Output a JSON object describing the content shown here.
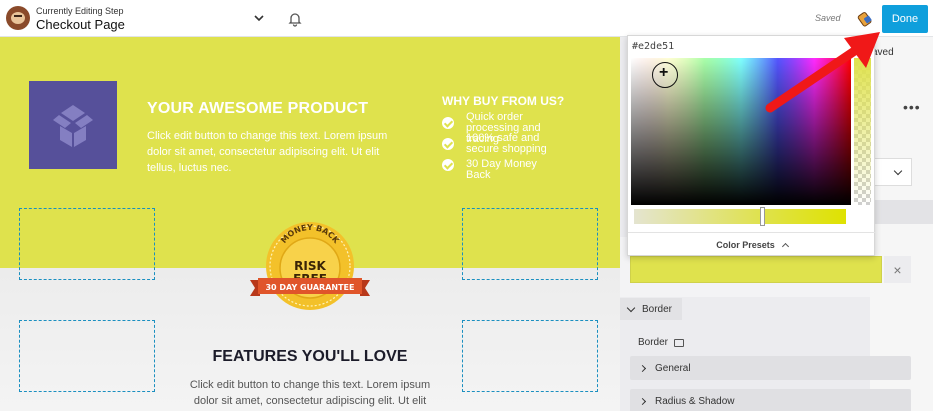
{
  "topbar": {
    "step_label": "Currently Editing Step",
    "step_title": "Checkout Page",
    "saved_text": "Saved",
    "done_label": "Done",
    "accent_color": "#0f9fdc"
  },
  "canvas": {
    "hero": {
      "background": "#dfe24d",
      "product_title": "YOUR AWESOME PRODUCT",
      "product_text": "Click edit button to change this text. Lorem ipsum dolor sit amet, consectetur adipiscing elit. Ut elit tellus, luctus nec.",
      "why_title": "WHY BUY FROM US?",
      "why_items": [
        "Quick order processing and tracing",
        "100% safe and secure shopping",
        "30 Day Money Back"
      ]
    },
    "badge": {
      "top_text": "MONEY BACK",
      "main_line1": "RISK",
      "main_line2": "FREE",
      "ribbon_text": "30 DAY GUARANTEE"
    },
    "features": {
      "title": "FEATURES YOU'LL LOVE",
      "text": "Click edit button to change this text. Lorem ipsum dolor sit amet, consectetur adipiscing elit. Ut elit"
    }
  },
  "color_picker": {
    "hex_value": "#e2de51",
    "presets_label": "Color Presets"
  },
  "panel": {
    "saved_fragment": "aved",
    "selected_color": "#dfe24d",
    "clear_label": "×",
    "border_section_label": "Border",
    "border_field_label": "Border",
    "accordions": [
      "General",
      "Radius & Shadow"
    ]
  },
  "icons": [
    "beaver-logo-icon",
    "chevron-down-icon",
    "bell-icon",
    "pencil-eraser-icon",
    "box-icon",
    "check-circle-icon",
    "monitor-icon",
    "chevron-right-icon",
    "chevron-up-icon",
    "close-icon",
    "more-dots-icon"
  ]
}
